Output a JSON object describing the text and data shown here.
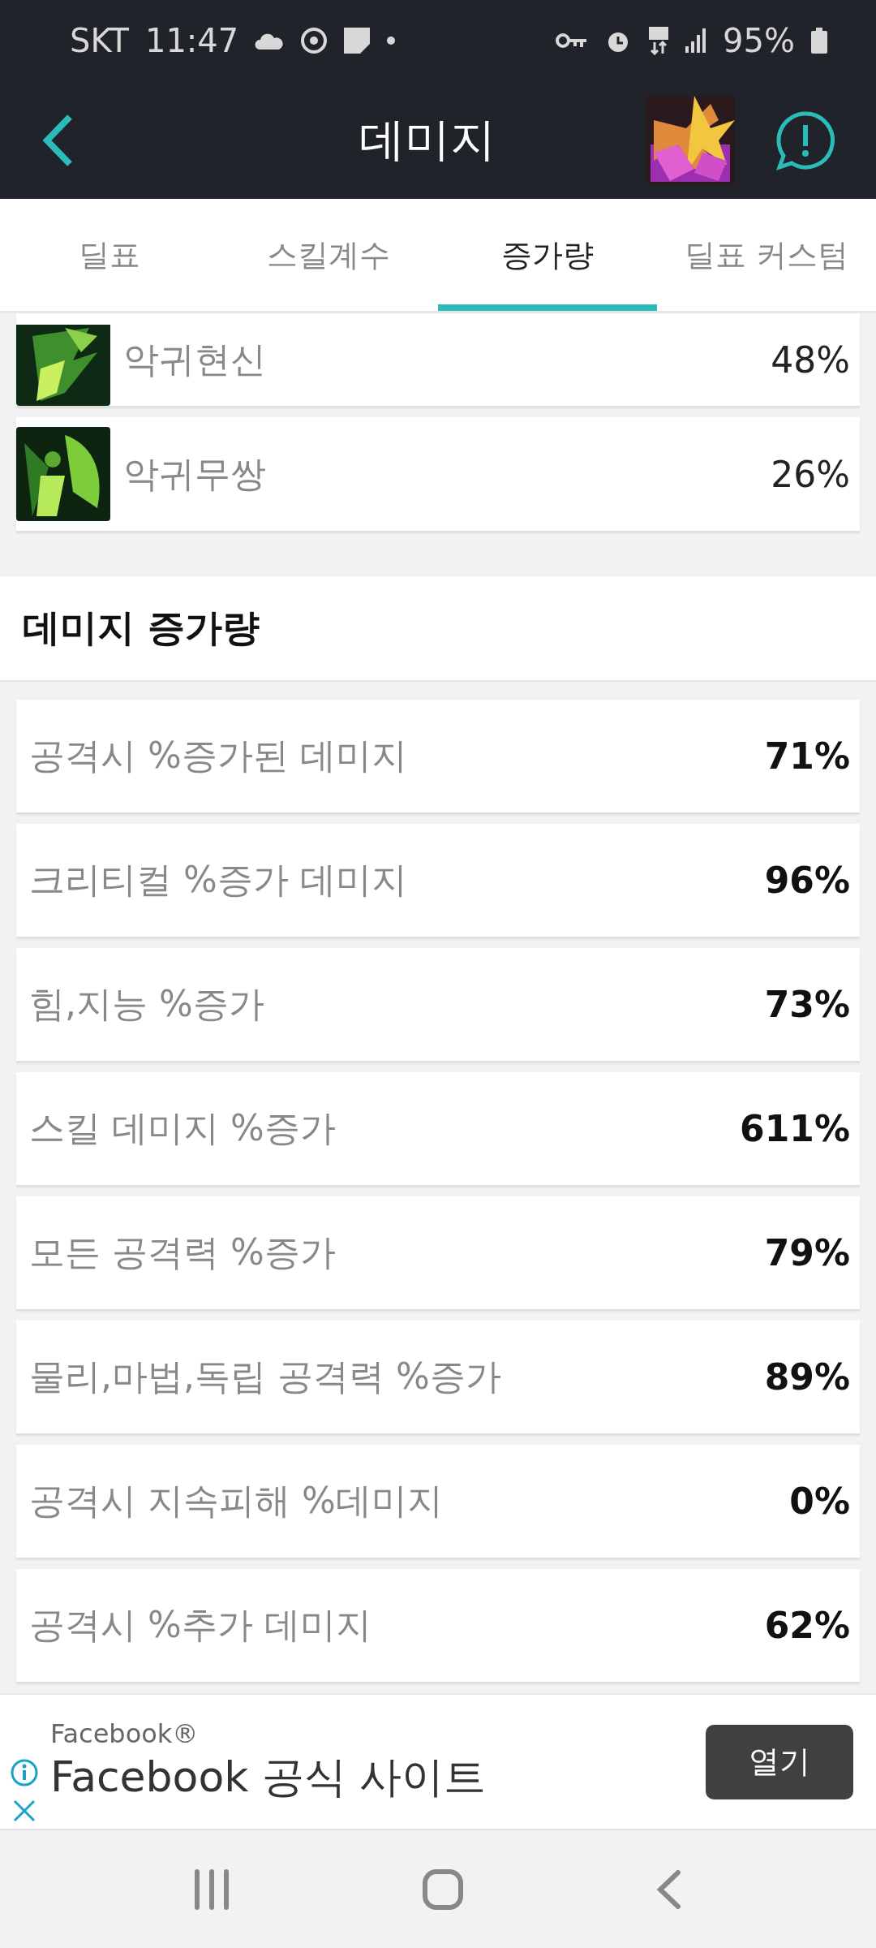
{
  "status_bar": {
    "carrier": "SKT",
    "time": "11:47",
    "battery": "95%"
  },
  "app_bar": {
    "title": "데미지"
  },
  "tabs": [
    {
      "label": "딜표",
      "selected": false
    },
    {
      "label": "스킬계수",
      "selected": false
    },
    {
      "label": "증가량",
      "selected": true
    },
    {
      "label": "딜표 커스텀",
      "selected": false
    }
  ],
  "skills": [
    {
      "name": "악귀현신",
      "value": "48%",
      "cut": true
    },
    {
      "name": "악귀무쌍",
      "value": "26%",
      "cut": false
    }
  ],
  "section": {
    "title": "데미지 증가량"
  },
  "stats": [
    {
      "label": "공격시 %증가된 데미지",
      "value": "71%"
    },
    {
      "label": "크리티컬 %증가 데미지",
      "value": "96%"
    },
    {
      "label": "힘,지능 %증가",
      "value": "73%"
    },
    {
      "label": "스킬 데미지 %증가",
      "value": "611%"
    },
    {
      "label": "모든 공격력 %증가",
      "value": "79%"
    },
    {
      "label": "물리,마법,독립 공격력 %증가",
      "value": "89%"
    },
    {
      "label": "공격시 지속피해 %데미지",
      "value": "0%"
    },
    {
      "label": "공격시 %추가 데미지",
      "value": "62%"
    }
  ],
  "ad": {
    "advertiser": "Facebook®",
    "headline": "Facebook 공식 사이트",
    "button": "열기"
  }
}
